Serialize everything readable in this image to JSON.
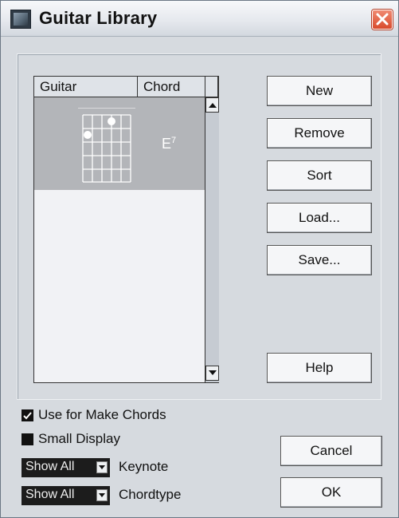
{
  "window": {
    "title": "Guitar Library"
  },
  "list": {
    "columns": [
      "Guitar",
      "Chord"
    ],
    "rows": [
      {
        "chord": "E",
        "chord_ext": "7",
        "selected": true
      }
    ]
  },
  "buttons": {
    "new": "New",
    "remove": "Remove",
    "sort": "Sort",
    "load": "Load...",
    "save": "Save...",
    "help": "Help",
    "cancel": "Cancel",
    "ok": "OK"
  },
  "options": {
    "use_for_make_chords": {
      "label": "Use for Make Chords",
      "checked": true
    },
    "small_display": {
      "label": "Small Display",
      "checked": false
    }
  },
  "filters": {
    "keynote": {
      "value": "Show All",
      "label": "Keynote"
    },
    "chordtype": {
      "value": "Show All",
      "label": "Chordtype"
    }
  },
  "icons": {
    "app": "app-icon",
    "close": "close-icon",
    "scroll_up": "arrow-up-icon",
    "scroll_down": "arrow-down-icon",
    "dropdown": "chevron-down-icon"
  }
}
